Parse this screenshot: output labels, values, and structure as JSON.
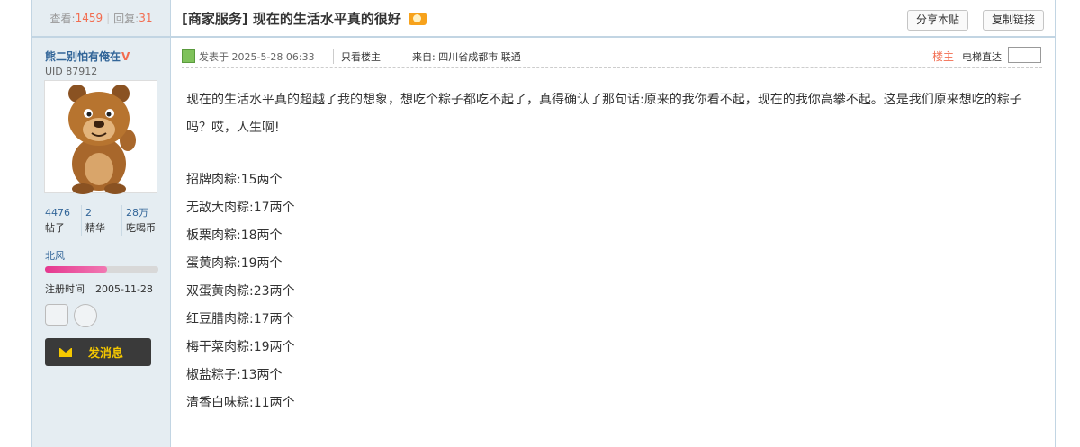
{
  "thread": {
    "views_label": "查看:",
    "views": "1459",
    "replies_label": "回复:",
    "replies": "31",
    "title": "[商家服务] 现在的生活水平真的很好",
    "share_label": "分享本贴",
    "copy_label": "复制链接"
  },
  "author": {
    "name": "熊二别怕有俺在",
    "verified_mark": "V",
    "uid": "UID 87912",
    "stats": [
      {
        "value": "4476",
        "label": "帖子"
      },
      {
        "value": "2",
        "label": "精华"
      },
      {
        "value": "28万",
        "label": "吃喝币"
      }
    ],
    "group": "北风",
    "level_progress": 0.55,
    "reg_label": "注册时间",
    "reg_date": "2005-11-28",
    "message_label": "发消息"
  },
  "post": {
    "posted": "发表于 2025-5-28 06:33",
    "only_op": "只看楼主",
    "from": "来自:  四川省成都市 联通",
    "floor": "楼主",
    "jump_label": "电梯直达",
    "intro": "现在的生活水平真的超越了我的想象，想吃个粽子都吃不起了，真得确认了那句话:原来的我你看不起，现在的我你高攀不起。这是我们原来想吃的粽子吗？哎，人生啊!",
    "items": [
      "招牌肉粽:15两个",
      "无敌大肉粽:17两个",
      "板栗肉粽:18两个",
      "蛋黄肉粽:19两个",
      "双蛋黄肉粽:23两个",
      "红豆腊肉粽:17两个",
      "梅干菜肉粽:19两个",
      "椒盐粽子:13两个",
      "清香白味粽:11两个"
    ]
  },
  "colors": {
    "accent": "#336699",
    "highlight": "#f26c4f",
    "sidebar_bg": "#e5edf2",
    "button_gold": "#f5c800"
  },
  "icons": [
    "hot-icon",
    "online-icon",
    "profile-card-icon",
    "user-circle-icon",
    "envelope-icon"
  ]
}
